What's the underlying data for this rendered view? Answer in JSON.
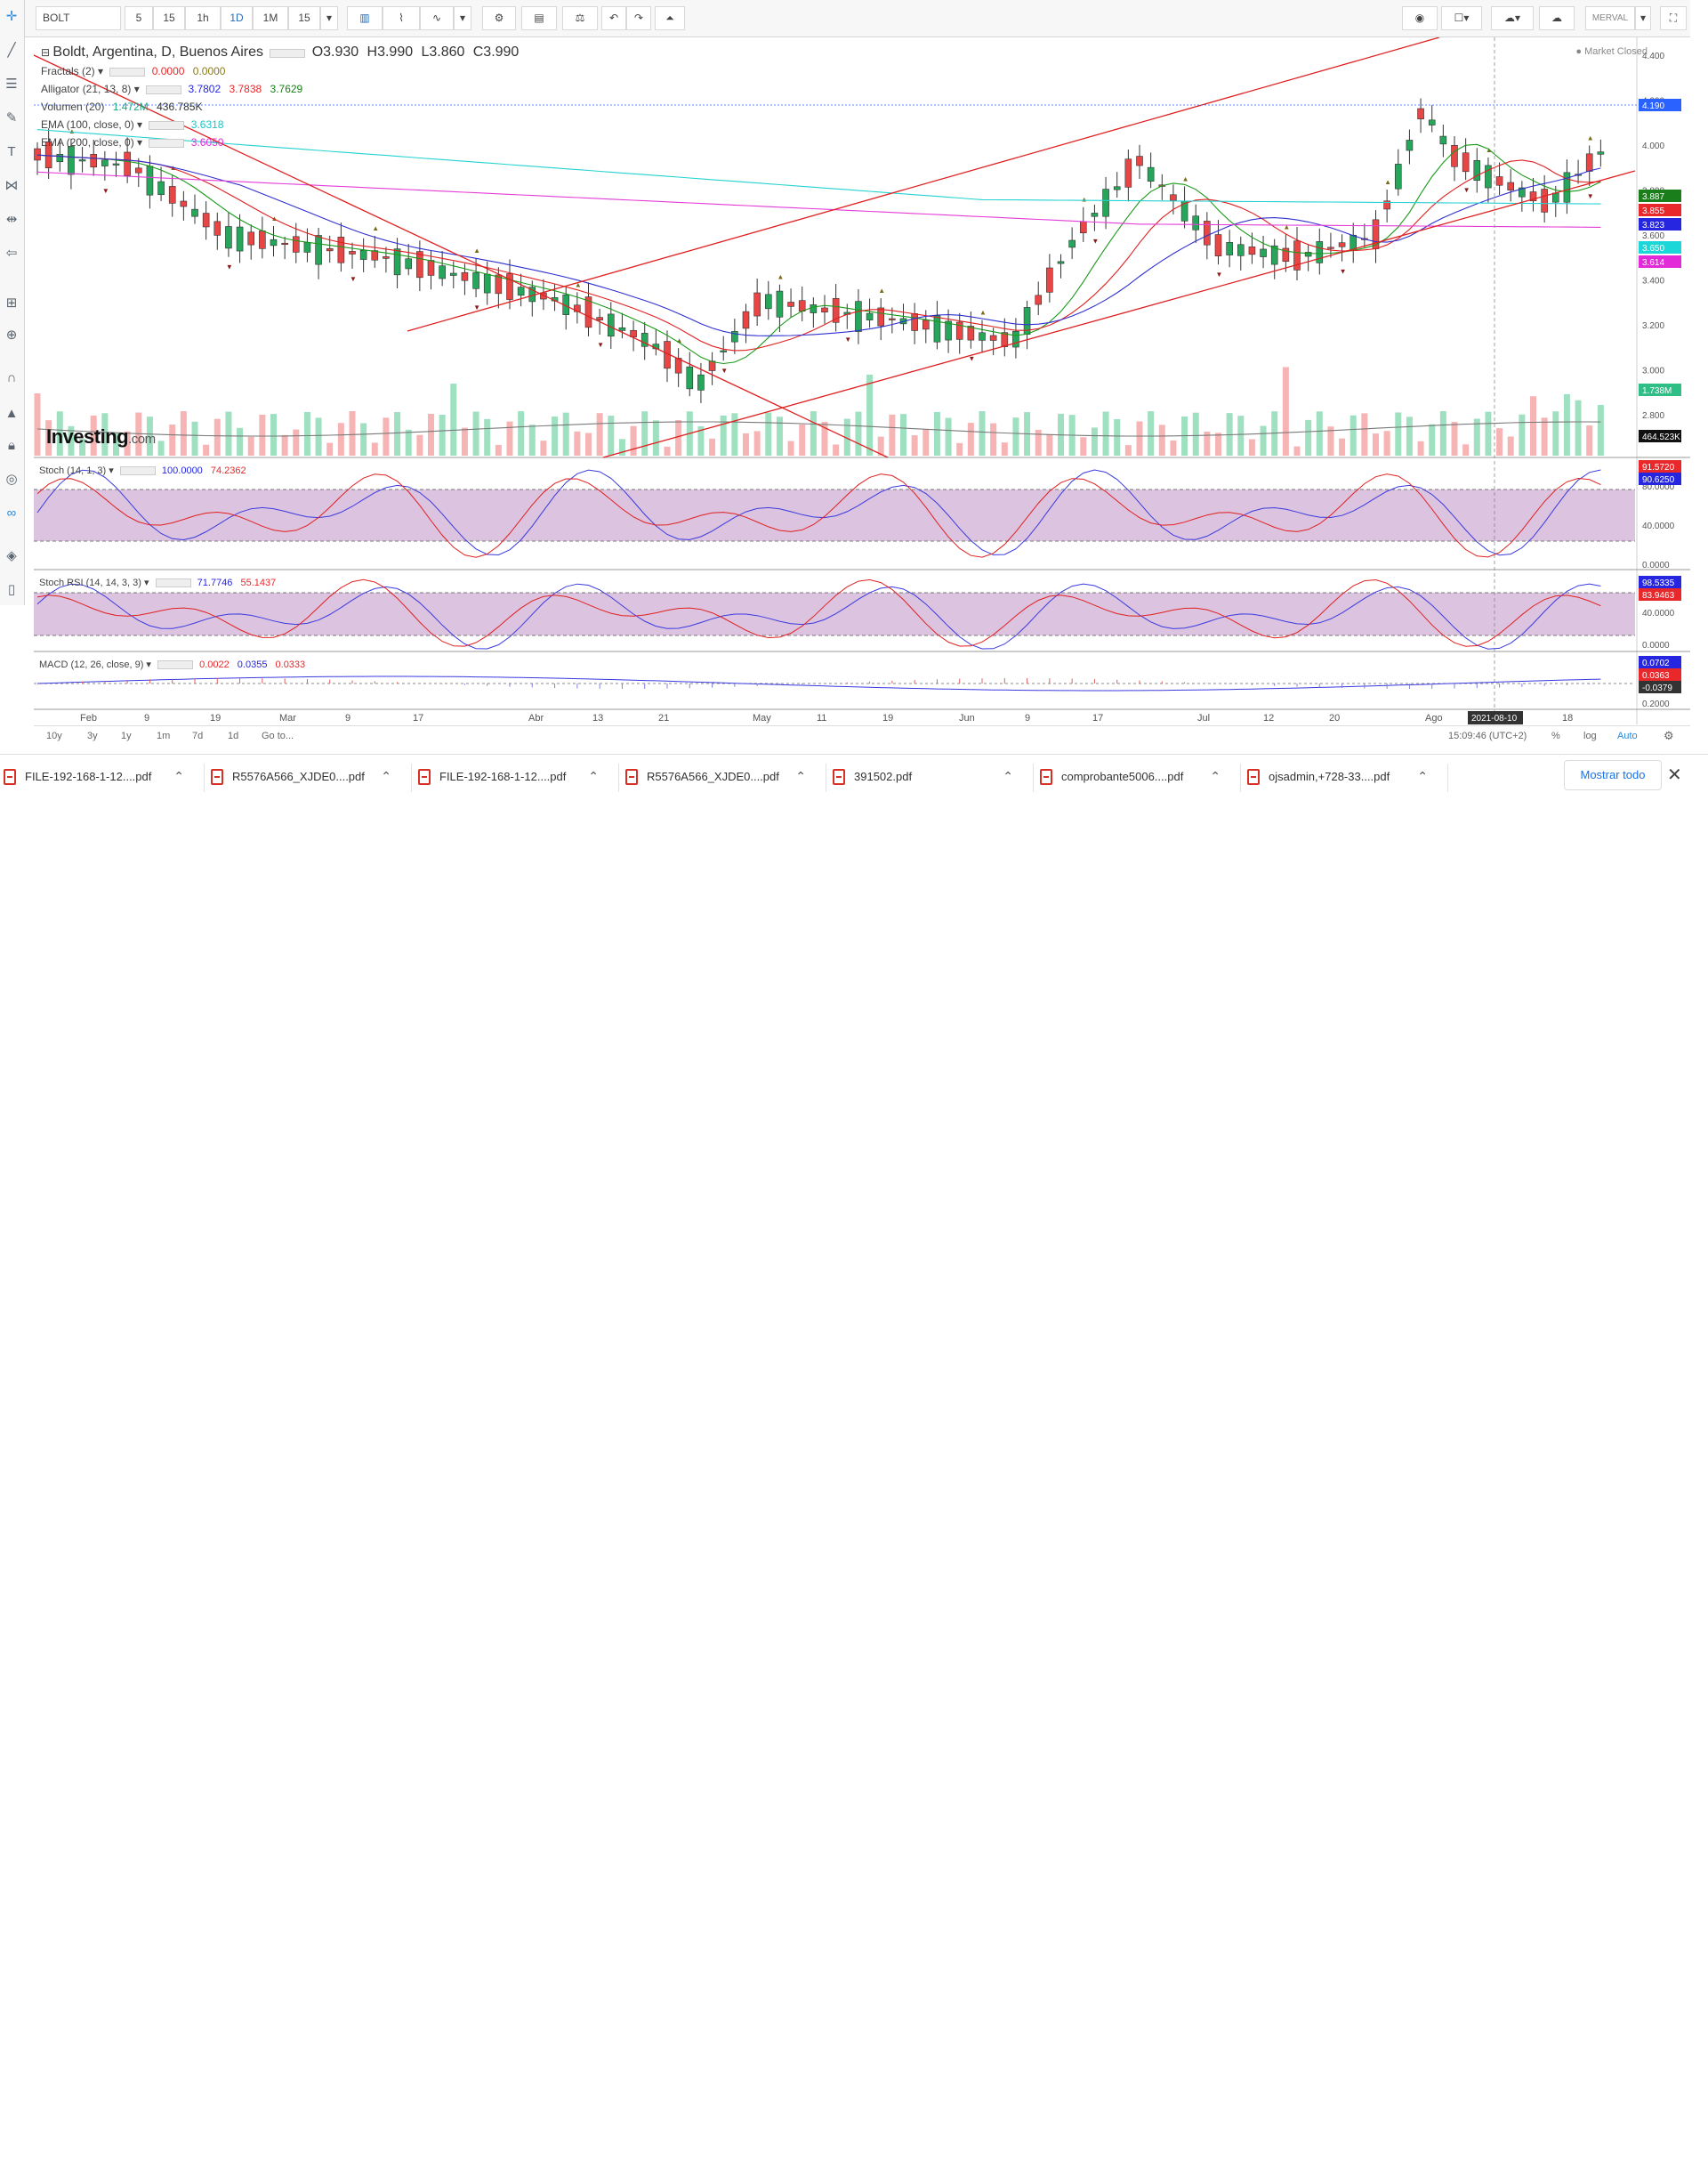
{
  "toolbar": {
    "symbol": "BOLT",
    "intervals": [
      "5",
      "15",
      "1h",
      "1D",
      "1M",
      "15"
    ],
    "active_interval": "1D",
    "exchange_button": "MERVAL"
  },
  "left_tools": [
    "crosshair-icon",
    "trendline-icon",
    "fib-icon",
    "brush-icon",
    "text-icon",
    "pattern-icon",
    "projection-icon",
    "arrow-icon",
    "measure-icon",
    "zoom-icon",
    "magnet-icon",
    "lock-icon",
    "lock-drawing-icon",
    "eye-icon",
    "link-icon",
    "layers-icon",
    "trash-icon"
  ],
  "legend": {
    "title": "Boldt, Argentina, D, Buenos Aires",
    "open": "O3.930",
    "high": "H3.990",
    "low": "L3.860",
    "close": "C3.990",
    "fractals": {
      "label": "Fractals (2)",
      "v1": "0.0000",
      "v2": "0.0000"
    },
    "alligator": {
      "label": "Alligator (21, 13, 8)",
      "v1": "3.7802",
      "v2": "3.7838",
      "v3": "3.7629"
    },
    "volume": {
      "label": "Volumen (20)",
      "v1": "1.472M",
      "v2": "436.785K"
    },
    "ema1": {
      "label": "EMA (100, close, 0)",
      "v1": "3.6318"
    },
    "ema2": {
      "label": "EMA (200, close, 0)",
      "v1": "3.6050"
    },
    "market_status": "Market Closed"
  },
  "price_axis": {
    "ticks": [
      "4.400",
      "4.200",
      "4.000",
      "3.800",
      "3.600",
      "3.400",
      "3.200",
      "3.000",
      "2.800"
    ],
    "badges": [
      {
        "text": "4.190",
        "color": "#2962ff"
      },
      {
        "text": "3.887",
        "color": "#1a7f1a"
      },
      {
        "text": "3.855",
        "color": "#e8282b"
      },
      {
        "text": "3.823",
        "color": "#2626e0"
      },
      {
        "text": "3.650",
        "color": "#1cd7d7"
      },
      {
        "text": "3.614",
        "color": "#e32ad8"
      },
      {
        "text": "1.738M",
        "color": "#2fbe86"
      },
      {
        "text": "464.523K",
        "color": "#111111"
      }
    ]
  },
  "stoch": {
    "label": "Stoch (14, 1, 3)",
    "v1": "100.0000",
    "v2": "74.2362",
    "ticks": [
      "80.0000",
      "40.0000",
      "0.0000"
    ],
    "badges": [
      {
        "text": "91.5720",
        "color": "#e8282b"
      },
      {
        "text": "90.6250",
        "color": "#2626e0"
      }
    ]
  },
  "stoch_rsi": {
    "label": "Stoch RSI (14, 14, 3, 3)",
    "v1": "71.7746",
    "v2": "55.1437",
    "ticks": [
      "40.0000",
      "0.0000"
    ],
    "badges": [
      {
        "text": "98.5335",
        "color": "#2626e0"
      },
      {
        "text": "83.9463",
        "color": "#e8282b"
      }
    ]
  },
  "macd": {
    "label": "MACD (12, 26, close, 9)",
    "v1": "0.0022",
    "v2": "0.0355",
    "v3": "0.0333",
    "badges": [
      {
        "text": "0.0702",
        "color": "#2626e0"
      },
      {
        "text": "0.0363",
        "color": "#e8282b"
      },
      {
        "text": "-0.0379",
        "color": "#333333"
      }
    ],
    "tick": "0.2000"
  },
  "time_axis": {
    "ticks": [
      "Feb",
      "9",
      "19",
      "Mar",
      "9",
      "17",
      "Abr",
      "13",
      "21",
      "May",
      "11",
      "19",
      "Jun",
      "9",
      "17",
      "Jul",
      "12",
      "20",
      "Ago",
      "18"
    ],
    "cursor_date": "2021-08-10"
  },
  "bottom_bar": {
    "ranges": [
      "10y",
      "3y",
      "1y",
      "1m",
      "7d",
      "1d",
      "Go to..."
    ],
    "clock": "15:09:46 (UTC+2)",
    "percent": "%",
    "log": "log",
    "auto": "Auto"
  },
  "downloads": {
    "files": [
      "FILE-192-168-1-12....pdf",
      "R5576A566_XJDE0....pdf",
      "FILE-192-168-1-12....pdf",
      "R5576A566_XJDE0....pdf",
      "391502.pdf",
      "comprobante5006....pdf",
      "ojsadmin,+728-33....pdf"
    ],
    "show_all": "Mostrar todo"
  }
}
